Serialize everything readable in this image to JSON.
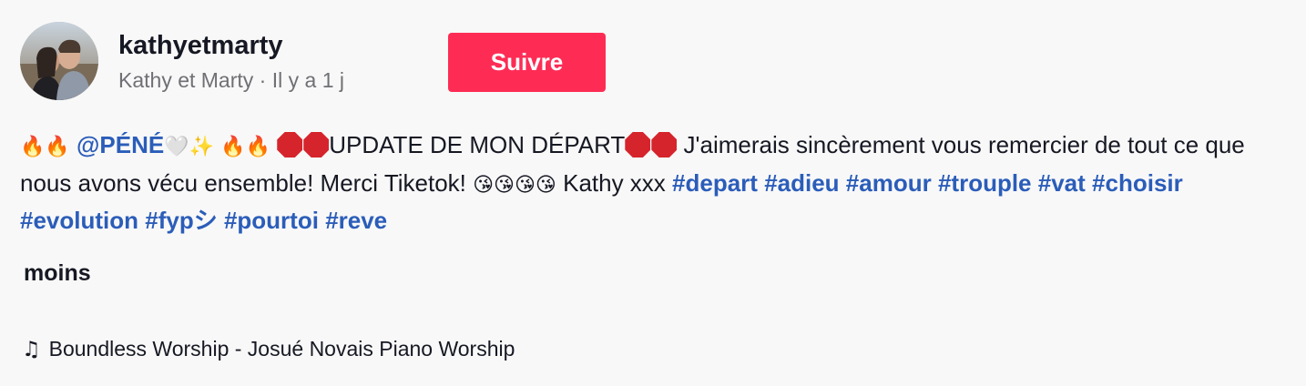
{
  "author": {
    "username": "kathyetmarty",
    "display_name": "Kathy et Marty",
    "separator": " · ",
    "time_ago": "Il y a 1 j",
    "avatar_icon": "avatar-photo"
  },
  "follow_button": {
    "label": "Suivre",
    "color": "#fe2c55"
  },
  "caption": {
    "emoji_fire": "🔥🔥",
    "mention": "@PÉNÉ",
    "emoji_heart_sparkle": "🤍✨",
    "update_text": "UPDATE DE MON DÉPART",
    "body": " J'aimerais sincèrement vous remercier de tout ce que nous avons vécu ensemble! Merci Tiketok! ",
    "emoji_kisses": "😘😘😘😘",
    "signoff": " Kathy xxx ",
    "hashtags": [
      "#depart",
      "#adieu",
      "#amour",
      "#trouple",
      "#vat",
      "#choisir",
      "#evolution",
      "#fypシ",
      "#pourtoi",
      "#reve"
    ],
    "link_color": "#2b5db9"
  },
  "more_label": "moins",
  "music": {
    "icon": "music-note-icon",
    "title": "Boundless Worship - Josué Novais Piano Worship"
  }
}
